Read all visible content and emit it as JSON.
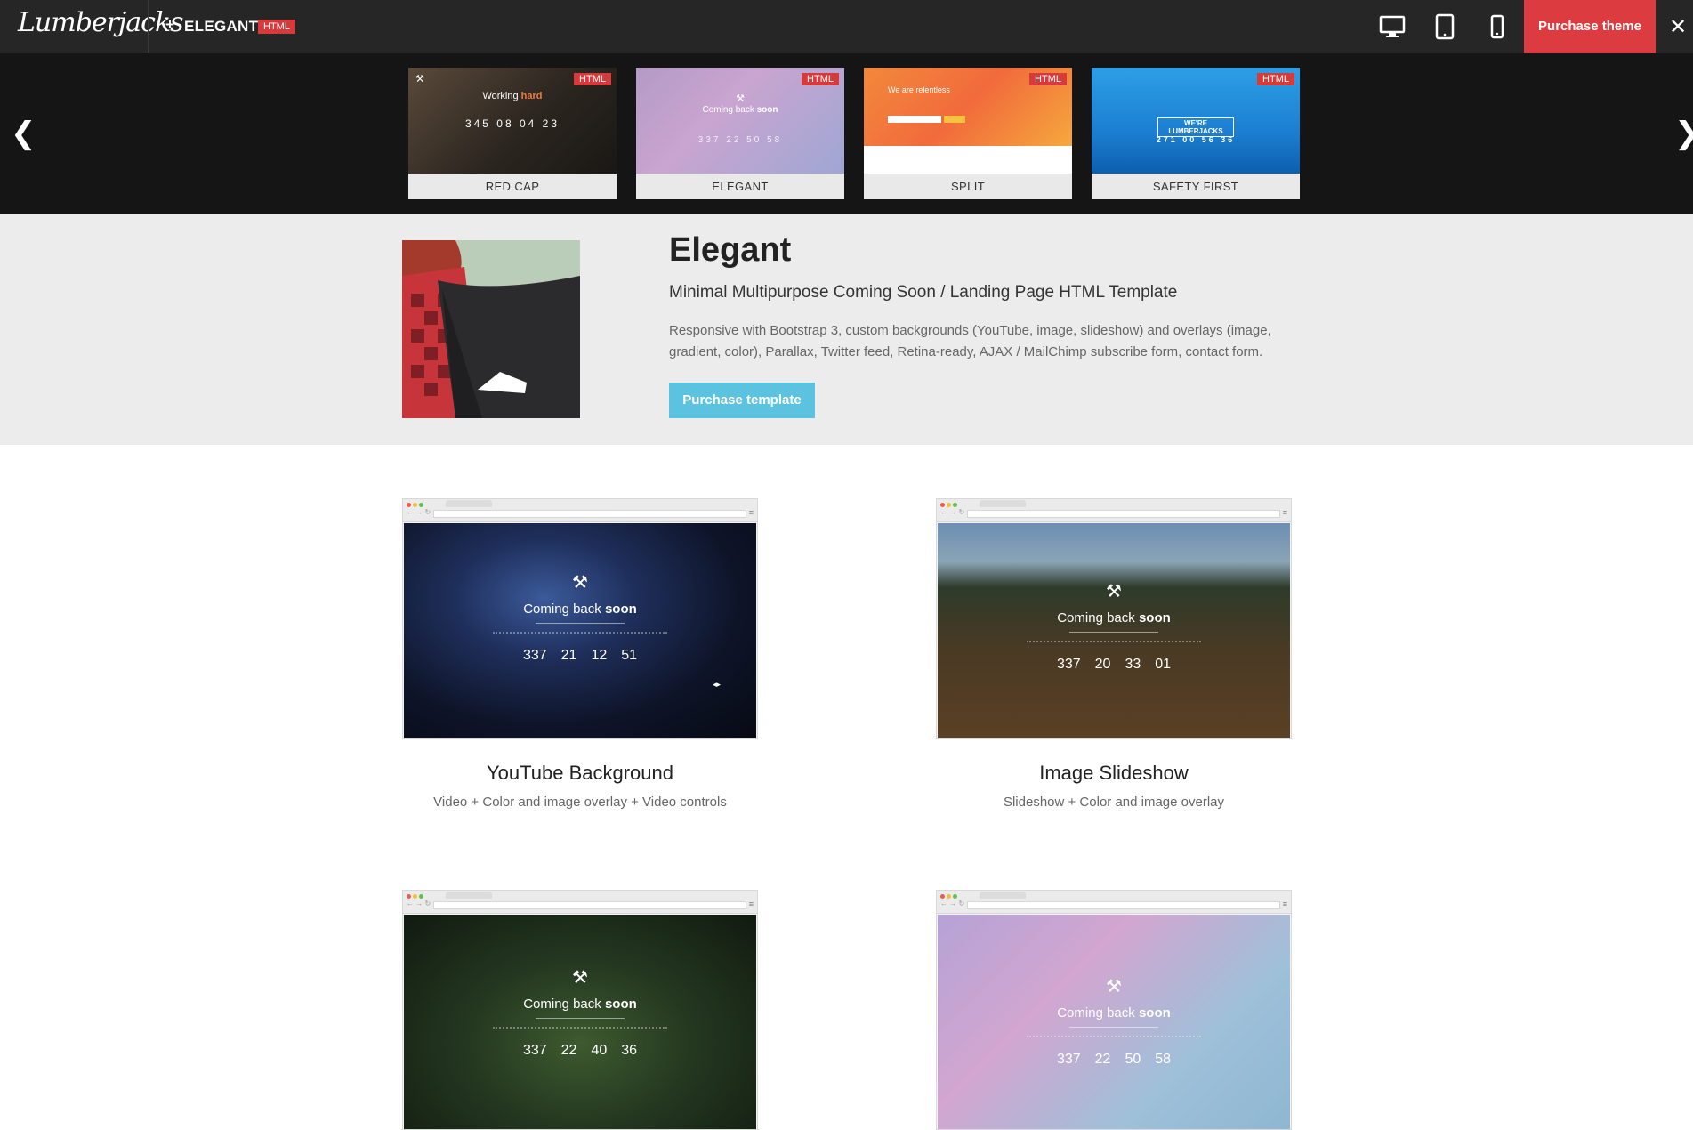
{
  "topbar": {
    "logo": "Lumberjacks",
    "plus": "+",
    "theme_name": "ELEGANT",
    "badge": "HTML",
    "devices": [
      "desktop-icon",
      "tablet-icon",
      "phone-icon"
    ],
    "purchase_label": "Purchase theme",
    "close": "✕"
  },
  "carousel": {
    "prev": "❮",
    "next": "❯",
    "items": [
      {
        "label": "RED CAP",
        "badge": "HTML",
        "title_a": "Working ",
        "title_b": "hard",
        "counts": "345 08 04 23"
      },
      {
        "label": "ELEGANT",
        "badge": "HTML",
        "title_a": "Coming back ",
        "title_b": "soon",
        "counts": "337 22 50 58"
      },
      {
        "label": "SPLIT",
        "badge": "HTML",
        "title_a": "We are relentless",
        "title_b": "",
        "counts": ""
      },
      {
        "label": "SAFETY FIRST",
        "badge": "HTML",
        "title_a": "WE'RE LUMBERJACKS",
        "title_b": "",
        "counts": "271 00 56 36"
      }
    ]
  },
  "hero": {
    "title": "Elegant",
    "subtitle": "Minimal Multipurpose Coming Soon / Landing Page HTML Template",
    "description": "Responsive with Bootstrap 3, custom backgrounds (YouTube, image, slideshow) and overlays (image, gradient, color), Parallax, Twitter feed, Retina-ready, AJAX / MailChimp subscribe form, contact form.",
    "button": "Purchase template"
  },
  "variants": [
    {
      "title": "YouTube Background",
      "subtitle": "Video + Color and image overlay + Video controls",
      "screen_title_a": "Coming back ",
      "screen_title_b": "soon",
      "counts": [
        "337",
        "21",
        "12",
        "51"
      ]
    },
    {
      "title": "Image Slideshow",
      "subtitle": "Slideshow + Color and image overlay",
      "screen_title_a": "Coming back ",
      "screen_title_b": "soon",
      "counts": [
        "337",
        "20",
        "33",
        "01"
      ]
    },
    {
      "title": "",
      "subtitle": "",
      "screen_title_a": "Coming back ",
      "screen_title_b": "soon",
      "counts": [
        "337",
        "22",
        "40",
        "36"
      ]
    },
    {
      "title": "",
      "subtitle": "",
      "screen_title_a": "Coming back ",
      "screen_title_b": "soon",
      "counts": [
        "337",
        "22",
        "50",
        "58"
      ]
    }
  ],
  "colors": {
    "topbar": "#262626",
    "accent_red": "#dc3b3f",
    "accent_blue": "#5bc3df",
    "hero_bg": "#ececec"
  }
}
